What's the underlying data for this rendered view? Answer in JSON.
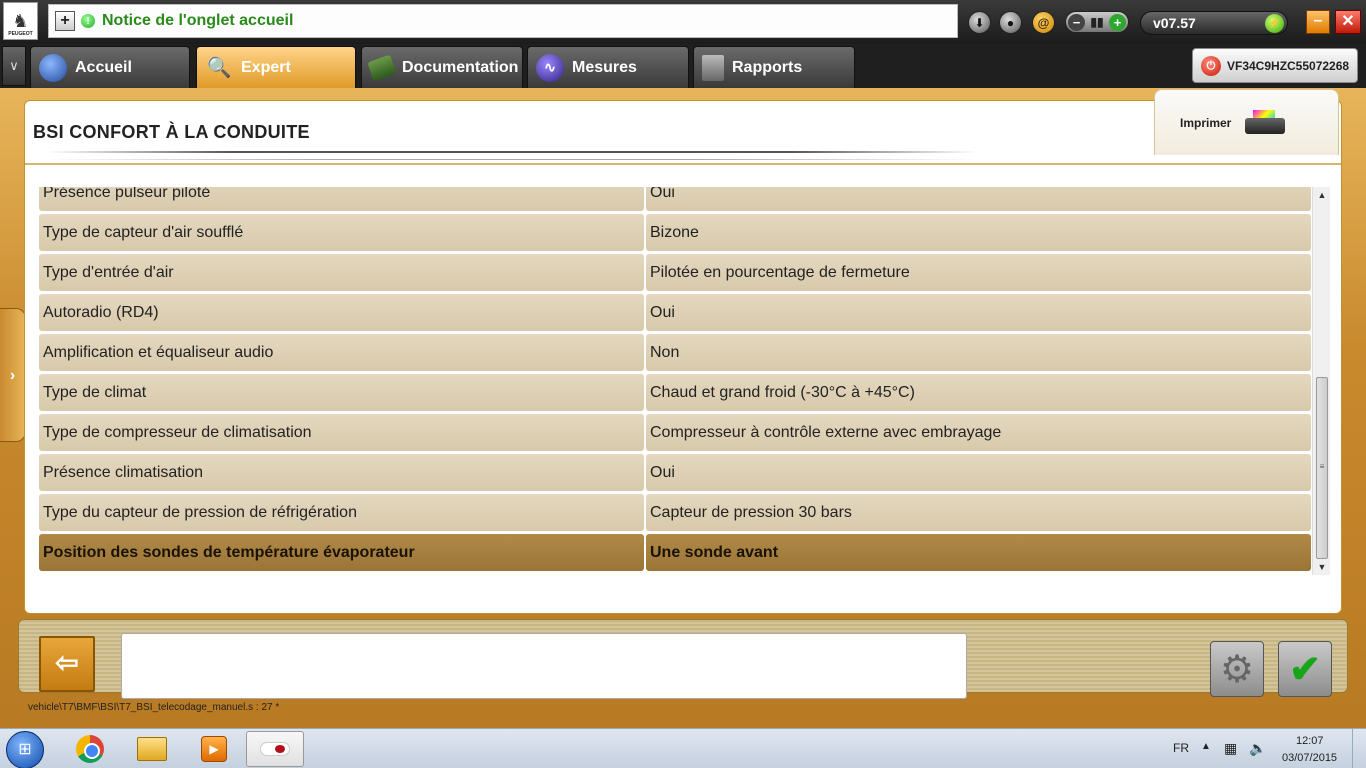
{
  "app": {
    "notice_title": "Notice de l'onglet accueil",
    "version": "v07.57",
    "brand_logo_text": "PEUGEOT",
    "vin": "VF34C9HZC55072268"
  },
  "nav": {
    "tabs": [
      {
        "label": "Accueil",
        "icon": "globe-icon"
      },
      {
        "label": "Expert",
        "icon": "magnifier-icon",
        "active": true
      },
      {
        "label": "Documentation",
        "icon": "book-icon"
      },
      {
        "label": "Mesures",
        "icon": "waveform-icon"
      },
      {
        "label": "Rapports",
        "icon": "document-icon"
      }
    ]
  },
  "main": {
    "title": "BSI  CONFORT À LA CONDUITE",
    "print_label": "Imprimer",
    "rows": [
      {
        "name": "Présence pulseur piloté",
        "value": "Oui"
      },
      {
        "name": "Type de capteur d'air soufflé",
        "value": "Bizone"
      },
      {
        "name": "Type d'entrée d'air",
        "value": "Pilotée en pourcentage de fermeture"
      },
      {
        "name": "Autoradio (RD4)",
        "value": "Oui"
      },
      {
        "name": "Amplification et équaliseur audio",
        "value": "Non"
      },
      {
        "name": "Type de climat",
        "value": "Chaud et grand froid (-30°C à +45°C)"
      },
      {
        "name": "Type de compresseur de climatisation",
        "value": "Compresseur à contrôle externe avec embrayage"
      },
      {
        "name": "Présence climatisation",
        "value": "Oui"
      },
      {
        "name": "Type du capteur de pression de réfrigération",
        "value": "Capteur de pression 30 bars"
      },
      {
        "name": "Position des sondes de température évaporateur",
        "value": "Une sonde avant",
        "selected": true
      }
    ]
  },
  "footer": {
    "script_path": "vehicle\\T7\\BMF\\BSI\\T7_BSI_telecodage_manuel.s : 27 *"
  },
  "taskbar": {
    "language": "FR",
    "time": "12:07",
    "date": "03/07/2015"
  },
  "colors": {
    "accent_orange": "#e09a28",
    "selected_row": "#9a7536",
    "row_bg": "#d8c9aa",
    "notice_text": "#2a8a1a"
  }
}
